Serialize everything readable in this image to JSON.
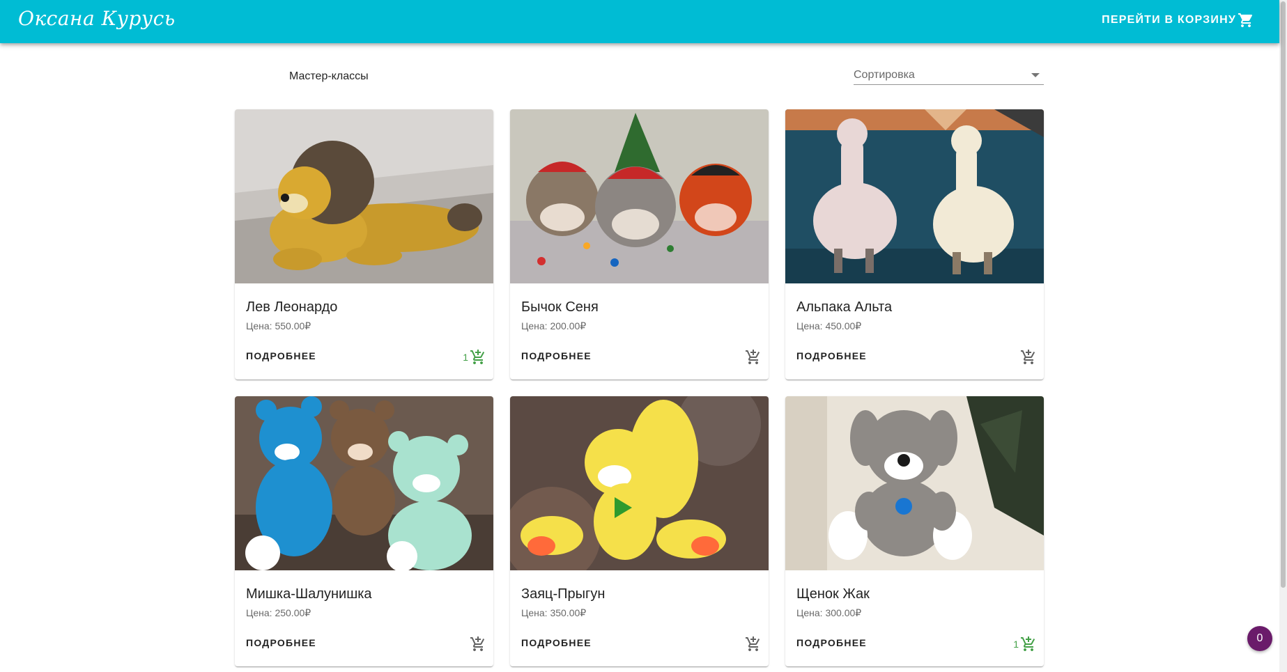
{
  "header": {
    "logo": "Оксана Курусь",
    "cart_link": "Перейти в корзину"
  },
  "category_label": "Мастер-классы",
  "sort": {
    "label": "Сортировка"
  },
  "product_actions": {
    "details_label": "Подробнее"
  },
  "products": [
    {
      "title": "Лев Леонардо",
      "price": "Цена: 550.00₽",
      "in_cart": "1",
      "cart_color": "#43a047"
    },
    {
      "title": "Бычок Сеня",
      "price": "Цена: 200.00₽",
      "in_cart": "",
      "cart_color": "#616161"
    },
    {
      "title": "Альпака Альта",
      "price": "Цена: 450.00₽",
      "in_cart": "",
      "cart_color": "#616161"
    },
    {
      "title": "Мишка-Шалунишка",
      "price": "Цена: 250.00₽",
      "in_cart": "",
      "cart_color": "#616161"
    },
    {
      "title": "Заяц-Прыгун",
      "price": "Цена: 350.00₽",
      "in_cart": "",
      "cart_color": "#616161"
    },
    {
      "title": "Щенок Жак",
      "price": "Цена: 300.00₽",
      "in_cart": "1",
      "cart_color": "#43a047"
    }
  ],
  "cart_total_badge": "0",
  "colors": {
    "primary": "#00bcd4",
    "badge": "#6a1b6a",
    "in_cart": "#43a047"
  }
}
